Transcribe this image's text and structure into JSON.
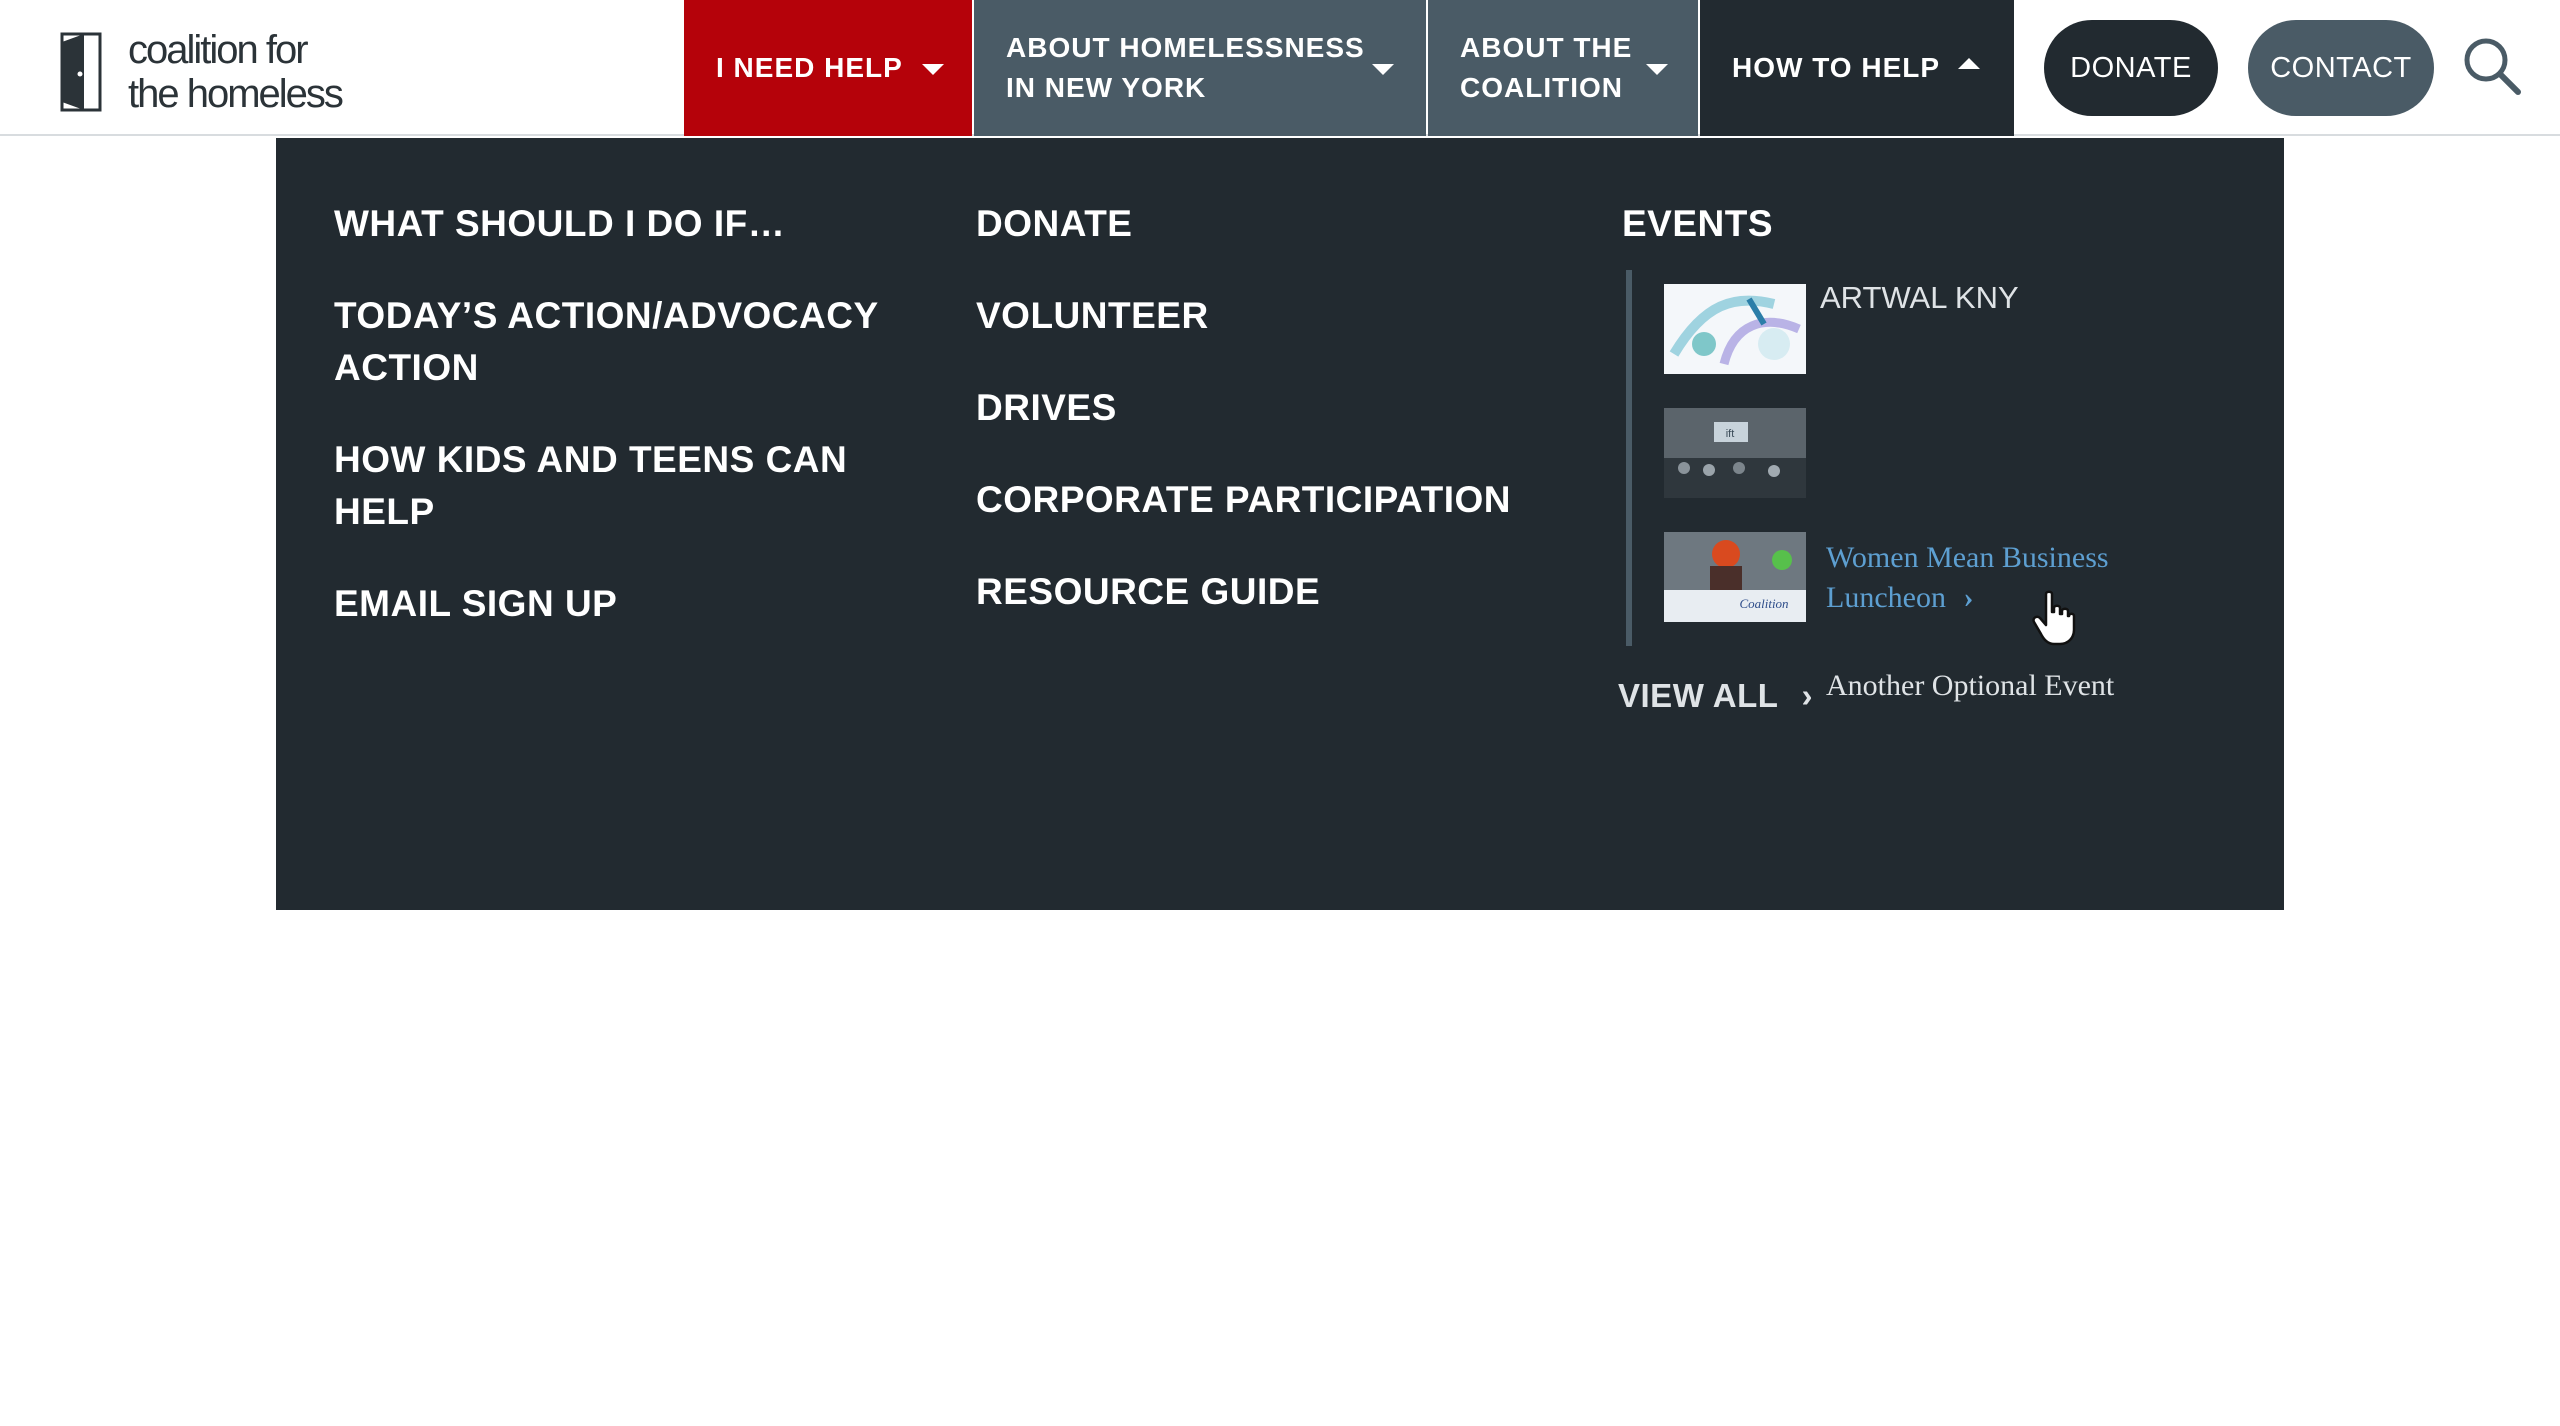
{
  "logo": {
    "line1": "coalition for",
    "line2": "the homeless",
    "icon": "door-icon"
  },
  "nav": {
    "need_help": "I NEED HELP",
    "about_homelessness_line1": "ABOUT HOMELESSNESS",
    "about_homelessness_line2": "IN NEW YORK",
    "about_coalition_line1": "ABOUT THE",
    "about_coalition_line2": "COALITION",
    "how_to_help": "HOW TO HELP",
    "donate": "DONATE",
    "contact": "CONTACT",
    "search_icon": "search-icon"
  },
  "menu": {
    "col1": [
      "WHAT SHOULD I DO IF…",
      "TODAY’S ACTION/ADVOCACY",
      "ACTION",
      "HOW KIDS AND TEENS CAN",
      "HELP",
      "EMAIL SIGN UP"
    ],
    "col2": [
      "DONATE",
      "VOLUNTEER",
      "DRIVES",
      "CORPORATE PARTICIPATION",
      "RESOURCE GUIDE"
    ],
    "events_title": "EVENTS",
    "events": [
      {
        "title": "ARTWAL KNY"
      },
      {
        "title_line1": "Women Mean Business",
        "title_line2": "Luncheon",
        "thumb_caption": "ift"
      },
      {
        "title": "Another Optional Event",
        "thumb_caption": "Coalition"
      }
    ],
    "view_all": "VIEW ALL"
  },
  "colors": {
    "need_help_red": "#b5020a",
    "nav_slate": "#4a5b66",
    "dark": "#222a30",
    "link_blue": "#5d9fd1"
  }
}
